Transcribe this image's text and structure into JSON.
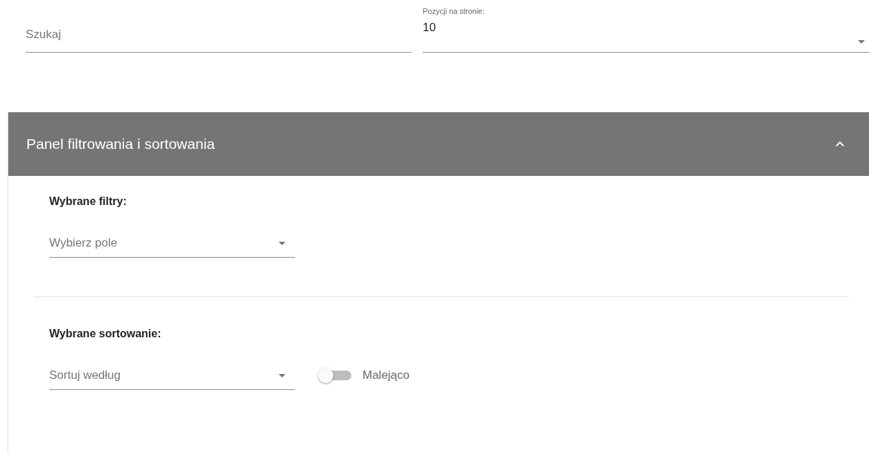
{
  "search": {
    "placeholder": "Szukaj"
  },
  "page_size": {
    "label": "Pozycji na stronie:",
    "value": "10"
  },
  "panel": {
    "title": "Panel filtrowania i sortowania",
    "expanded": true,
    "filters": {
      "heading": "Wybrane filtry:",
      "select_placeholder": "Wybierz pole"
    },
    "sorting": {
      "heading": "Wybrane sortowanie:",
      "select_placeholder": "Sortuj według",
      "descending": {
        "label": "Malejąco",
        "on": false
      }
    }
  }
}
